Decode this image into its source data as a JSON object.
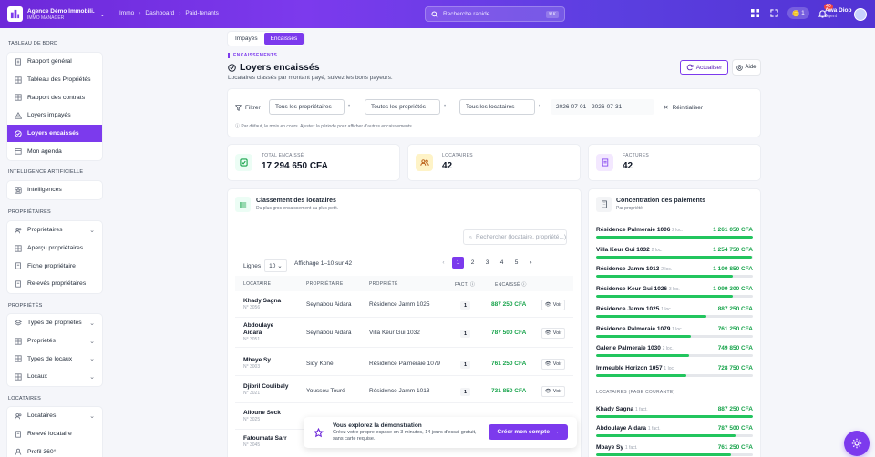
{
  "app": {
    "name": "Agence Démo Immobili...",
    "subtitle": "IMMO MANAGER"
  },
  "breadcrumb": [
    "Immo",
    "Dashboard",
    "Paid-tenants"
  ],
  "search": {
    "placeholder": "Recherche rapide...",
    "shortcut": "⌘K"
  },
  "topbar": {
    "wallet_value": "1",
    "notif_count": "40",
    "user_name": "Awa Diop",
    "user_role": "Agent"
  },
  "sidebar": {
    "sections": [
      {
        "title": "TABLEAU DE BORD",
        "items": [
          {
            "label": "Rapport général",
            "icon": "file-icon"
          },
          {
            "label": "Tableau des Propriétés",
            "icon": "grid-icon"
          },
          {
            "label": "Rapport des contrats",
            "icon": "grid-icon"
          },
          {
            "label": "Loyers impayés",
            "icon": "alert-icon"
          },
          {
            "label": "Loyers encaissés",
            "icon": "check-icon",
            "active": true
          },
          {
            "label": "Mon agenda",
            "icon": "calendar-icon"
          }
        ]
      },
      {
        "title": "INTELLIGENCE ARTIFICIELLE",
        "items": [
          {
            "label": "Intelligences",
            "icon": "star-icon"
          }
        ]
      },
      {
        "title": "PROPRIÉTAIRES",
        "items": [
          {
            "label": "Propriétaires",
            "icon": "users-icon",
            "chevron": true
          },
          {
            "label": "Aperçu propriétaires",
            "icon": "grid-icon"
          },
          {
            "label": "Fiche propriétaire",
            "icon": "doc-icon"
          },
          {
            "label": "Relevés propriétaires",
            "icon": "doc-icon"
          }
        ]
      },
      {
        "title": "PROPRIÉTÉS",
        "items": [
          {
            "label": "Types de propriétés",
            "icon": "layers-icon",
            "chevron": true
          },
          {
            "label": "Propriétés",
            "icon": "grid-icon",
            "chevron": true
          },
          {
            "label": "Types de locaux",
            "icon": "grid-icon",
            "chevron": true
          },
          {
            "label": "Locaux",
            "icon": "grid-icon",
            "chevron": true
          }
        ]
      },
      {
        "title": "LOCATAIRES",
        "items": [
          {
            "label": "Locataires",
            "icon": "users-icon",
            "chevron": true
          },
          {
            "label": "Relevé locataire",
            "icon": "doc-icon"
          },
          {
            "label": "Profil 360°",
            "icon": "user-icon"
          }
        ]
      }
    ]
  },
  "tabs": [
    {
      "label": "Impayés",
      "active": false
    },
    {
      "label": "Encaissés",
      "active": true
    }
  ],
  "header": {
    "eyebrow": "ENCAISSEMENTS",
    "title": "Loyers encaissés",
    "subtitle": "Locataires classés par montant payé, suivez les bons payeurs.",
    "refresh_label": "Actualiser",
    "help_label": "Aide"
  },
  "filters": {
    "label": "Filtrer",
    "owner": "Tous les propriétaires",
    "property": "Toutes les propriétés",
    "tenant": "Tous les locataires",
    "date_range": "2026-07-01 - 2026-07-31",
    "reset_label": "Réinitialiser",
    "note": "Par défaut, le mois en cours. Ajustez la période pour afficher d'autres encaissements."
  },
  "kpis": [
    {
      "label": "TOTAL ENCAISSÉ",
      "value": "17 294 650 CFA"
    },
    {
      "label": "LOCATAIRES",
      "value": "42"
    },
    {
      "label": "FACTURES",
      "value": "42"
    }
  ],
  "ranking": {
    "title": "Classement des locataires",
    "subtitle": "Du plus gros encaissement au plus petit.",
    "search_placeholder": "Rechercher (locataire, propriété...)",
    "lines_label": "Lignes",
    "lines_value": "10",
    "display_text": "Affichage 1–10 sur 42",
    "pages": [
      "1",
      "2",
      "3",
      "4",
      "5"
    ],
    "columns": [
      "LOCATAIRE",
      "PROPRIÉTAIRE",
      "PROPRIÉTÉ",
      "FACT.",
      "ENCAISSÉ"
    ],
    "view_label": "Voir",
    "rows": [
      {
        "name": "Khady Sagna",
        "id": "N° 3056",
        "owner": "Seynabou Aidara",
        "property": "Résidence Jamm 1025",
        "fact": "1",
        "amount": "887 250 CFA"
      },
      {
        "name": "Abdoulaye Aidara",
        "id": "N° 3051",
        "owner": "Seynabou Aidara",
        "property": "Villa Keur Gui 1032",
        "fact": "1",
        "amount": "787 500 CFA"
      },
      {
        "name": "Mbaye Sy",
        "id": "N° 3003",
        "owner": "Sidy Koné",
        "property": "Résidence Palmeraie 1079",
        "fact": "1",
        "amount": "761 250 CFA"
      },
      {
        "name": "Djibril Coulibaly",
        "id": "N° 3021",
        "owner": "Youssou Touré",
        "property": "Résidence Jamm 1013",
        "fact": "1",
        "amount": "731 850 CFA"
      },
      {
        "name": "Alioune Seck",
        "id": "N° 3025",
        "owner": "",
        "property": "",
        "fact": "",
        "amount": ""
      },
      {
        "name": "Fatoumata Sarr",
        "id": "N° 3045",
        "owner": "",
        "property": "",
        "fact": "",
        "amount": ""
      }
    ]
  },
  "concentration": {
    "title": "Concentration des paiements",
    "subtitle": "Par propriété",
    "properties": [
      {
        "name": "Résidence Palmeraie 1006",
        "count": "2 loc.",
        "value": "1 261 050 CFA",
        "fill": 1.0
      },
      {
        "name": "Villa Keur Gui 1032",
        "count": "2 loc.",
        "value": "1 254 750 CFA",
        "fill": 0.995
      },
      {
        "name": "Résidence Jamm 1013",
        "count": "2 loc.",
        "value": "1 100 850 CFA",
        "fill": 0.873
      },
      {
        "name": "Résidence Keur Gui 1026",
        "count": "3 loc.",
        "value": "1 099 300 CFA",
        "fill": 0.872
      },
      {
        "name": "Résidence Jamm 1025",
        "count": "1 loc.",
        "value": "887 250 CFA",
        "fill": 0.704
      },
      {
        "name": "Résidence Palmeraie 1079",
        "count": "1 loc.",
        "value": "761 250 CFA",
        "fill": 0.604
      },
      {
        "name": "Galerie Palmeraie 1030",
        "count": "2 loc.",
        "value": "749 850 CFA",
        "fill": 0.595
      },
      {
        "name": "Immeuble Horizon 1057",
        "count": "1 loc.",
        "value": "728 750 CFA",
        "fill": 0.578
      }
    ],
    "tenants_title": "LOCATAIRES (PAGE COURANTE)",
    "tenants": [
      {
        "name": "Khady Sagna",
        "count": "1 fact.",
        "value": "887 250 CFA",
        "fill": 1.0
      },
      {
        "name": "Abdoulaye Aidara",
        "count": "1 fact.",
        "value": "787 500 CFA",
        "fill": 0.888
      },
      {
        "name": "Mbaye Sy",
        "count": "1 fact.",
        "value": "761 250 CFA",
        "fill": 0.858
      }
    ]
  },
  "demo_banner": {
    "title": "Vous explorez la démonstration",
    "text": "Créez votre propre espace en 3 minutes, 14 jours d'essai gratuit, sans carte requise.",
    "cta": "Créer mon compte"
  },
  "colors": {
    "accent": "#7c3aed",
    "success": "#16a34a",
    "bar": "#22c55e"
  }
}
